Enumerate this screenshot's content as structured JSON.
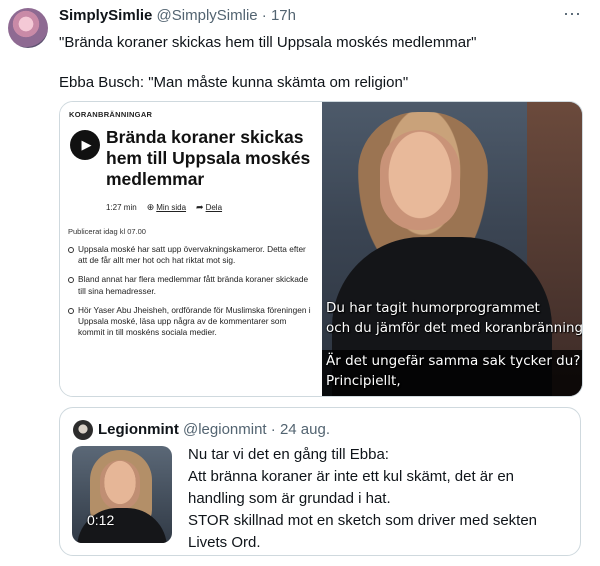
{
  "tweet": {
    "author_name": "SimplySimlie",
    "author_handle": "@SimplySimlie",
    "separator": "·",
    "time": "17h",
    "more_icon": "more-icon",
    "text_line1": "\"Brända koraner skickas hem till Uppsala moskés medlemmar\"",
    "text_line2": "Ebba Busch: \"Man måste kunna skämta om religion\""
  },
  "media": {
    "article": {
      "kicker": "KORANBRÄNNINGAR",
      "headline": "Brända koraner skickas hem till Uppsala moskés medlemmar",
      "duration": "1:27 min",
      "my_page": "Min sida",
      "share": "Dela",
      "published": "Publicerat idag kl 07.00",
      "bullets": [
        "Uppsala moské har satt upp övervakningskameror. Detta efter att de får allt mer hot och hat riktat mot sig.",
        "Bland annat har flera medlemmar fått brända koraner skickade till sina hemadresser.",
        "Hör Yaser Abu Jheisheh, ordförande för Muslimska föreningen i Uppsala moské, läsa upp några av de kommentarer som kommit in till moskéns sociala medier."
      ]
    },
    "tv": {
      "subtitle_1_line1": "Du har tagit humorprogrammet",
      "subtitle_1_line2": "och du jämför det med koranbränningar.",
      "subtitle_2_line1": "Är det ungefär samma sak tycker du?",
      "subtitle_2_line2": "Principiellt,"
    }
  },
  "quote": {
    "author_name": "Legionmint",
    "author_handle": "@legionmint",
    "separator": "·",
    "date": "24 aug.",
    "video_duration": "0:12",
    "lines": [
      "Nu tar vi det en gång till Ebba:",
      "Att bränna koraner är inte ett kul skämt, det är en",
      "handling som är grundad i hat.",
      "STOR skillnad mot en sketch som driver med sekten",
      "Livets Ord."
    ]
  }
}
